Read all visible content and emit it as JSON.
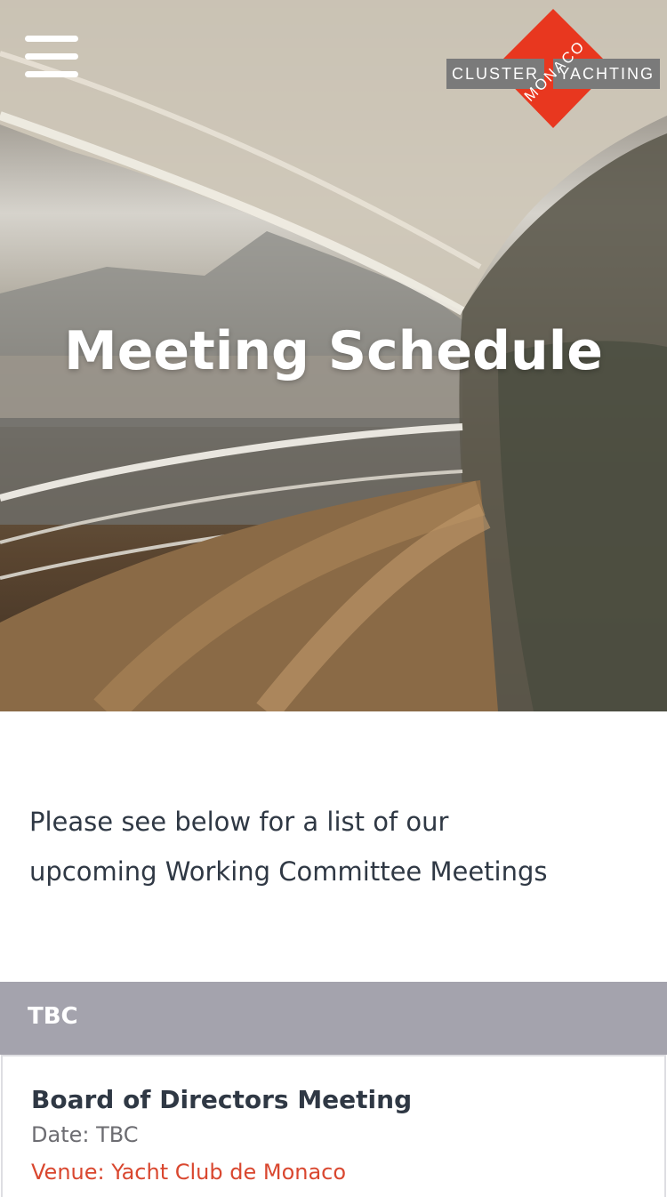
{
  "header": {
    "menu_icon": "hamburger-menu-icon",
    "logo": {
      "left_word": "CLUSTER",
      "center_word": "MONACO",
      "right_word": "YACHTING",
      "accent_color": "#e8371f"
    }
  },
  "hero": {
    "title": "Meeting Schedule"
  },
  "intro": {
    "line1": "Please see below for a list of our",
    "line2": "upcoming Working Committee Meetings"
  },
  "schedule": {
    "groups": [
      {
        "label": "TBC",
        "meetings": [
          {
            "title": "Board of Directors Meeting",
            "date": "Date: TBC",
            "venue": "Venue: Yacht Club de Monaco"
          }
        ]
      }
    ]
  },
  "colors": {
    "group_header_bg": "#a4a3ad",
    "venue_text": "#d9472f",
    "body_text": "#2f3844"
  }
}
